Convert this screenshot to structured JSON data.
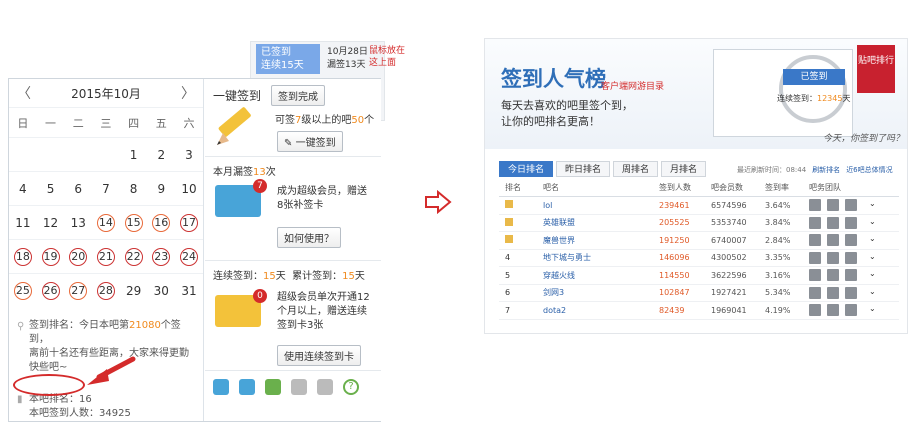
{
  "left": {
    "tooltip": {
      "signed_label": "已签到",
      "days_label": "连续15天",
      "date": "10月28日",
      "missed": "漏签13天",
      "note": "鼠标放在这上面"
    },
    "calendar": {
      "title": "2015年10月",
      "prev": "〈",
      "next": "〉",
      "weekdays": [
        "日",
        "一",
        "二",
        "三",
        "四",
        "五",
        "六"
      ],
      "weeks": [
        [
          {
            "d": ""
          },
          {
            "d": ""
          },
          {
            "d": ""
          },
          {
            "d": ""
          },
          {
            "d": "1"
          },
          {
            "d": "2"
          },
          {
            "d": "3"
          }
        ],
        [
          {
            "d": "4"
          },
          {
            "d": "5"
          },
          {
            "d": "6"
          },
          {
            "d": "7"
          },
          {
            "d": "8"
          },
          {
            "d": "9"
          },
          {
            "d": "10"
          }
        ],
        [
          {
            "d": "11"
          },
          {
            "d": "12"
          },
          {
            "d": "13"
          },
          {
            "d": "14",
            "s": "signed"
          },
          {
            "d": "15",
            "s": "signed"
          },
          {
            "d": "16",
            "s": "signed"
          },
          {
            "d": "17",
            "s": "missed"
          }
        ],
        [
          {
            "d": "18",
            "s": "missed"
          },
          {
            "d": "19",
            "s": "missed"
          },
          {
            "d": "20",
            "s": "missed"
          },
          {
            "d": "21",
            "s": "missed"
          },
          {
            "d": "22",
            "s": "missed"
          },
          {
            "d": "23",
            "s": "missed"
          },
          {
            "d": "24",
            "s": "missed"
          }
        ],
        [
          {
            "d": "25",
            "s": "signed"
          },
          {
            "d": "26",
            "s": "missed"
          },
          {
            "d": "27",
            "s": "signed"
          },
          {
            "d": "28",
            "s": "missed"
          },
          {
            "d": "29"
          },
          {
            "d": "30"
          },
          {
            "d": "31"
          }
        ]
      ],
      "rank_line1": "签到排名：今日本吧第",
      "rank_num": "21080",
      "rank_line1b": "个签到，",
      "rank_line2": "离前十名还有些距离，大家来得更勤快些吧~",
      "bar_rank": "本吧排名：16",
      "bar_total": "本吧签到人数：34925"
    },
    "side": {
      "onekey_title": "一键签到",
      "sign_done": "签到完成",
      "can_sign": "可签",
      "level": "7",
      "level_mid": "级以上的吧",
      "count": "50",
      "count_unit": "个",
      "onekey_btn": "一键签到",
      "missed_title": "本月漏签",
      "missed_num": "13",
      "missed_unit": "次",
      "vip_text": "成为超级会员，赠送8张补签卡",
      "how_btn": "如何使用？",
      "streak_label": "连续签到：",
      "streak_num": "15",
      "streak_unit": "天",
      "total_label": "累计签到：",
      "total_num": "15",
      "total_unit": "天",
      "vip2_text": "超级会员单次开通12个月以上，赠送连续签到卡3张",
      "use_btn": "使用连续签到卡",
      "card1_badge": "7",
      "card2_badge": "0"
    }
  },
  "right": {
    "title": "签到人气榜",
    "subtitle_tag": "客户端网游目录",
    "slogan1": "每天去喜欢的吧里签个到，",
    "slogan2": "让你的吧排名更高！",
    "badge": "贴吧排行",
    "mini_signed": "已签到",
    "mini_streak_label": "连续签到：",
    "mini_streak_num": "12345",
    "mini_streak_unit": "天",
    "handwriting": "今天，你签到了吗？",
    "tabs": [
      "今日排名",
      "昨日排名",
      "周排名",
      "月排名"
    ],
    "update_label": "最近刷新时间：08:44",
    "refresh": "刷新排名",
    "recent_link": "近6吧总体情况",
    "headers": [
      "排名",
      "吧名",
      "签到人数",
      "吧会员数",
      "签到率",
      "吧务团队"
    ],
    "rows": [
      {
        "rank": "1",
        "name": "lol",
        "signed": "239461",
        "members": "6574596",
        "rate": "3.64%"
      },
      {
        "rank": "2",
        "name": "英雄联盟",
        "signed": "205525",
        "members": "5353740",
        "rate": "3.84%"
      },
      {
        "rank": "3",
        "name": "魔兽世界",
        "signed": "191250",
        "members": "6740007",
        "rate": "2.84%"
      },
      {
        "rank": "4",
        "name": "地下城与勇士",
        "signed": "146096",
        "members": "4300502",
        "rate": "3.35%"
      },
      {
        "rank": "5",
        "name": "穿越火线",
        "signed": "114550",
        "members": "3622596",
        "rate": "3.16%"
      },
      {
        "rank": "6",
        "name": "剑网3",
        "signed": "102847",
        "members": "1927421",
        "rate": "5.34%"
      },
      {
        "rank": "7",
        "name": "dota2",
        "signed": "82439",
        "members": "1969041",
        "rate": "4.19%"
      }
    ]
  },
  "colors": {
    "accent": "#3a78c8",
    "signed_ring": "#e86a3a",
    "missed_ring": "#cc3333",
    "orange": "#f08a1e",
    "red": "#d42b2b"
  }
}
